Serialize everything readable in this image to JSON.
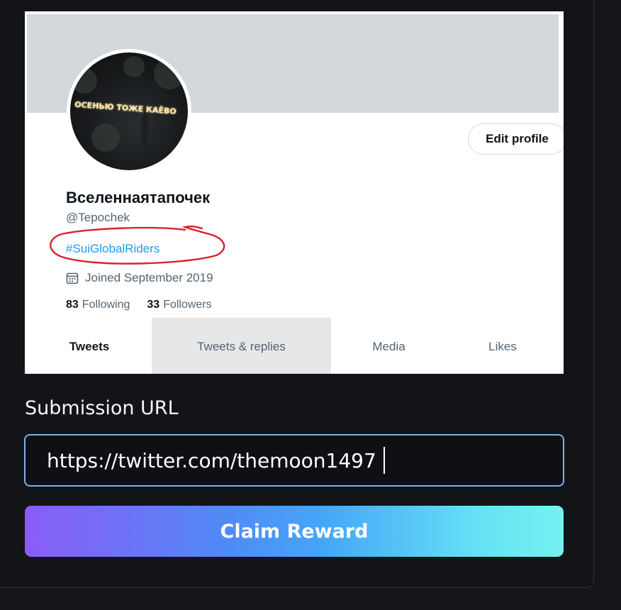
{
  "profile": {
    "edit_profile_label": "Edit profile",
    "display_name": "Вселеннаятапочек",
    "handle": "@Tepochek",
    "hashtag": "#SuiGlobalRiders",
    "joined": "Joined September 2019",
    "following_count": "83",
    "following_label": "Following",
    "followers_count": "33",
    "followers_label": "Followers",
    "avatar_text": "ОСЕНЬЮ ТОЖЕ КАЁВО",
    "tabs": [
      {
        "label": "Tweets"
      },
      {
        "label": "Tweets & replies"
      },
      {
        "label": "Media"
      },
      {
        "label": "Likes"
      }
    ]
  },
  "form": {
    "submission_label": "Submission URL",
    "url_value": "https://twitter.com/themoon1497",
    "claim_label": "Claim Reward"
  },
  "colors": {
    "page_bg": "#141518",
    "accent_blue": "#1d9bf0",
    "annotation_red": "#d9222a",
    "input_border": "#7fb2e6",
    "button_gradient_start": "#8b5cf6",
    "button_gradient_end": "#74f2ef"
  },
  "icons": [
    "calendar-icon"
  ]
}
